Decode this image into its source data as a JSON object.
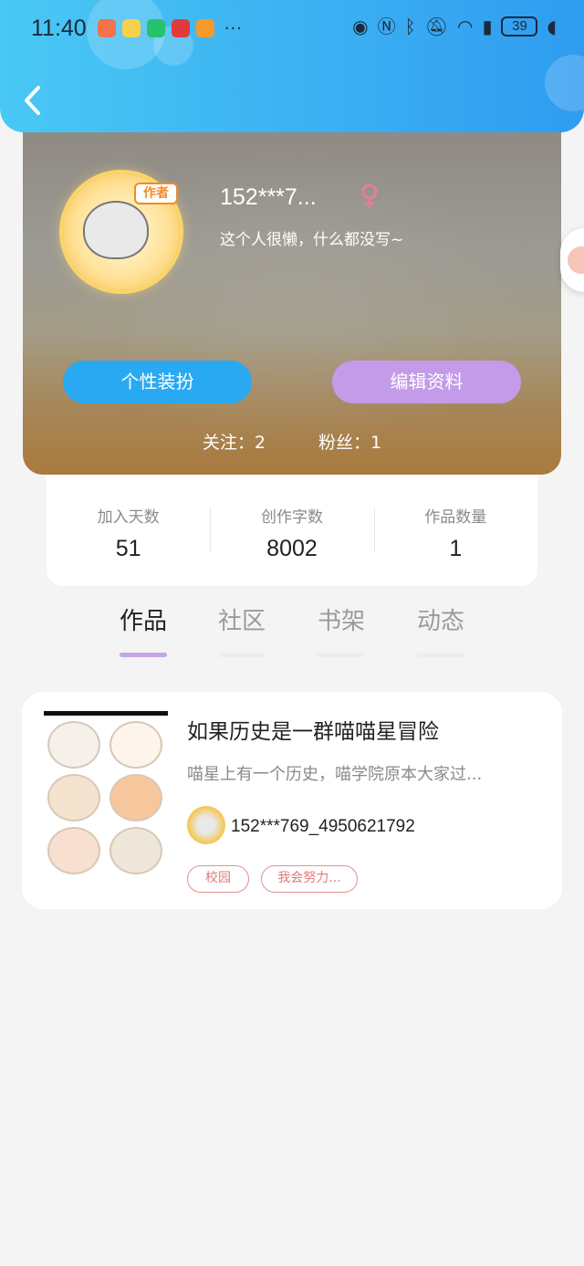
{
  "status_bar": {
    "time": "11:40",
    "more": "···",
    "battery": "39",
    "icons": [
      "eye-icon",
      "nfc-icon",
      "bluetooth-icon",
      "mute-icon",
      "wifi-icon",
      "sim-alert-icon",
      "battery-icon",
      "leaf-icon"
    ]
  },
  "header": {
    "back_icon": "chevron-left-icon"
  },
  "profile": {
    "avatar_badge": "作者",
    "nickname": "152***7...",
    "gender_icon": "female-icon",
    "bio": "这个人很懒，什么都没写~",
    "dress_button": "个性装扮",
    "edit_button": "编辑资料",
    "following": "关注：2",
    "followers": "粉丝：1"
  },
  "stats": [
    {
      "label": "加入天数",
      "value": "51"
    },
    {
      "label": "创作字数",
      "value": "8002"
    },
    {
      "label": "作品数量",
      "value": "1"
    }
  ],
  "tabs": [
    {
      "label": "作品",
      "active": true
    },
    {
      "label": "社区",
      "active": false
    },
    {
      "label": "书架",
      "active": false
    },
    {
      "label": "动态",
      "active": false
    }
  ],
  "works": [
    {
      "title": "如果历史是一群喵喵星冒险",
      "description": "喵星上有一个历史，喵学院原本大家过...",
      "author": "152***769_4950621792",
      "tags": [
        "校园",
        "我会努力..."
      ]
    }
  ],
  "colors": {
    "header_gradient_start": "#49c8f4",
    "header_gradient_end": "#2f9cf0",
    "dress_button": "#2aa9f3",
    "edit_button": "#c39be8",
    "tab_indicator": "#c5a6e3",
    "tag_border": "#e58f8f"
  }
}
